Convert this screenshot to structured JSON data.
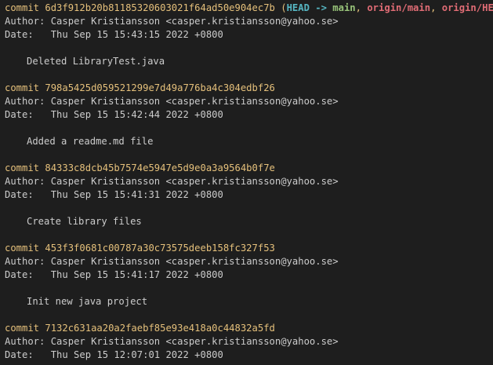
{
  "colors": {
    "background": "#1e1e1e",
    "text": "#cccccc",
    "commit": "#e5c07b",
    "head": "#56b6c2",
    "branch_local": "#98c379",
    "branch_remote": "#e06c75"
  },
  "labels": {
    "commit": "commit",
    "author": "Author:",
    "date": "Date:"
  },
  "commits": [
    {
      "hash": "6d3f912b20b81185320603021f64ad50e904ec7b",
      "refs": {
        "open": "(",
        "head": "HEAD",
        "arrow": "->",
        "local": "main",
        "sep1": ",",
        "remote1": "origin/main",
        "sep2": ",",
        "remote2": "origin/HEAD",
        "close": ")"
      },
      "author": "Casper Kristiansson <casper.kristiansson@yahoo.se>",
      "date": "Thu Sep 15 15:43:15 2022 +0800",
      "message": "Deleted LibraryTest.java"
    },
    {
      "hash": "798a5425d059521299e7d49a776ba4c304edbf26",
      "author": "Casper Kristiansson <casper.kristiansson@yahoo.se>",
      "date": "Thu Sep 15 15:42:44 2022 +0800",
      "message": "Added a readme.md file"
    },
    {
      "hash": "84333c8dcb45b7574e5947e5d9e0a3a9564b0f7e",
      "author": "Casper Kristiansson <casper.kristiansson@yahoo.se>",
      "date": "Thu Sep 15 15:41:31 2022 +0800",
      "message": "Create library files"
    },
    {
      "hash": "453f3f0681c00787a30c73575deeb158fc327f53",
      "author": "Casper Kristiansson <casper.kristiansson@yahoo.se>",
      "date": "Thu Sep 15 15:41:17 2022 +0800",
      "message": "Init new java project"
    },
    {
      "hash": "7132c631aa20a2faebf85e93e418a0c44832a5fd",
      "author": "Casper Kristiansson <casper.kristiansson@yahoo.se>",
      "date": "Thu Sep 15 12:07:01 2022 +0800"
    }
  ]
}
